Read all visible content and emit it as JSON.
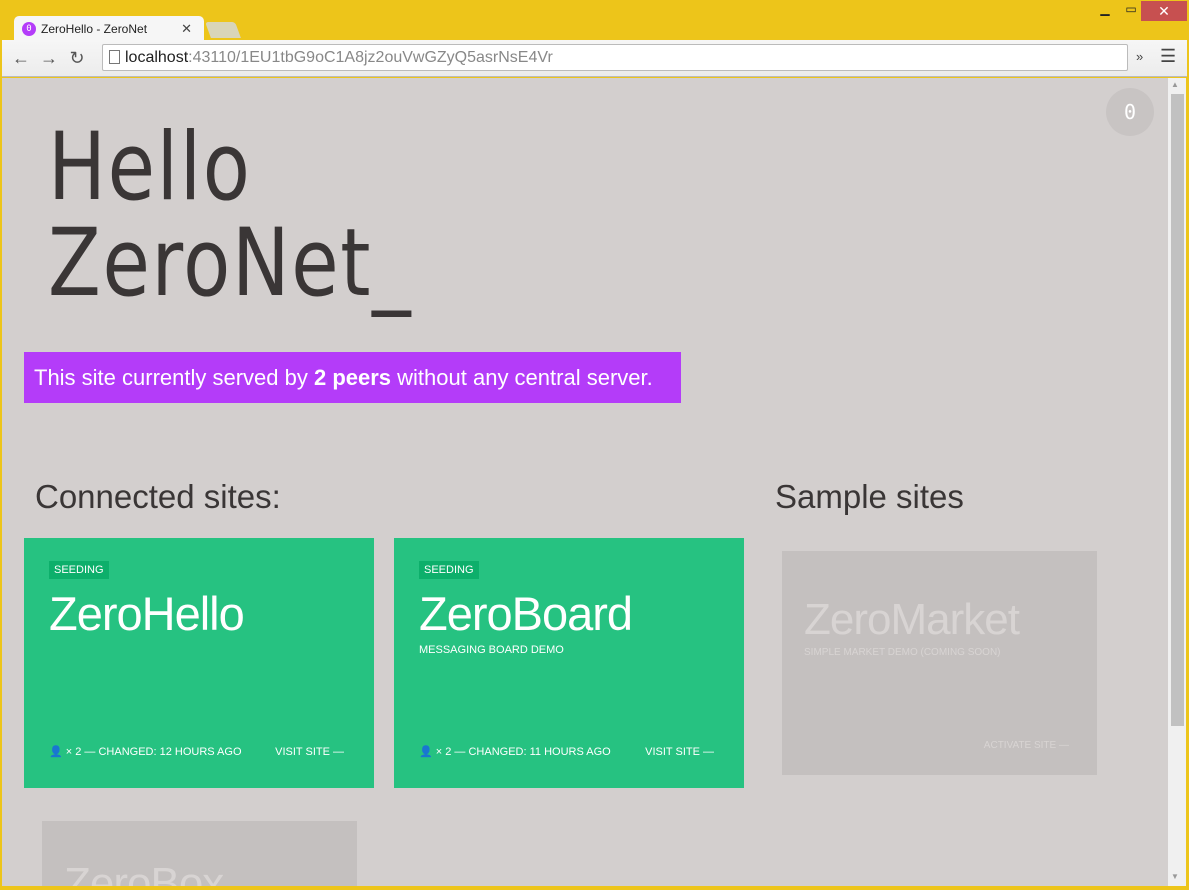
{
  "browser": {
    "tab_title": "ZeroHello - ZeroNet",
    "favicon_text": "0",
    "url_host": "localhost",
    "url_rest": ":43110/1EU1tbG9oC1A8jz2ouVwGZyQ5asrNsE4Vr"
  },
  "page": {
    "notification_count": "0",
    "title_line1": "Hello",
    "title_line2": "ZeroNet_",
    "peers_prefix": "This site currently served by ",
    "peers_bold": "2 peers",
    "peers_suffix": " without any central server.",
    "connected_heading": "Connected sites:",
    "sample_heading": "Sample sites"
  },
  "connected_sites": [
    {
      "badge": "SEEDING",
      "title": "ZeroHello",
      "description": "",
      "meta": "× 2 — CHANGED: 12 HOURS AGO",
      "action": "VISIT SITE —"
    },
    {
      "badge": "SEEDING",
      "title": "ZeroBoard",
      "description": "MESSAGING BOARD DEMO",
      "meta": "× 2 — CHANGED: 11 HOURS AGO",
      "action": "VISIT SITE —"
    }
  ],
  "sample_sites": [
    {
      "title": "ZeroMarket",
      "description": "SIMPLE MARKET DEMO (COMING SOON)",
      "action": "ACTIVATE SITE —"
    },
    {
      "title": "ZeroBox"
    }
  ],
  "colors": {
    "accent": "#B43CF9",
    "site_card": "#26C281",
    "badge": "#0DAF6B",
    "sample_card": "#C4C0BF",
    "background": "#D3CFCE"
  }
}
